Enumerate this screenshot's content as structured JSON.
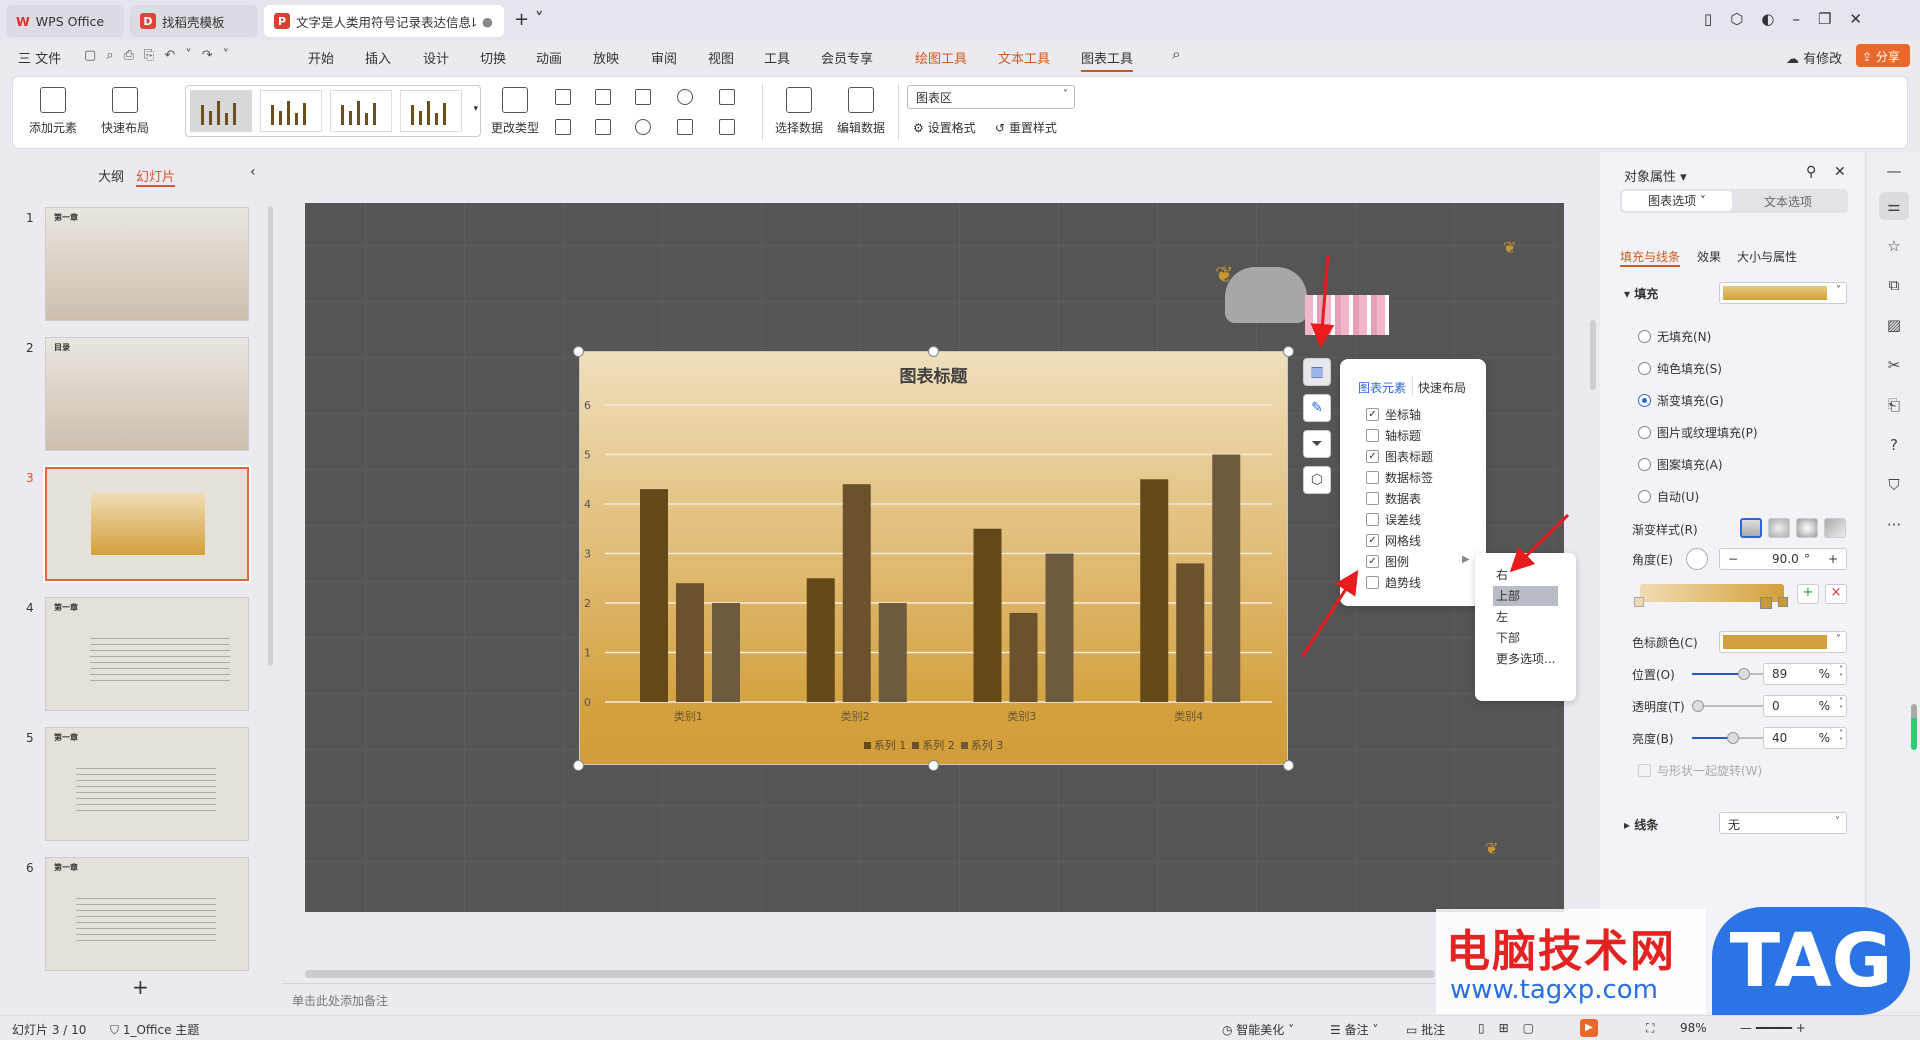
{
  "tabs": [
    {
      "label": "WPS Office",
      "icon": "wps-logo"
    },
    {
      "label": "找稻壳模板",
      "icon": "docer-icon"
    },
    {
      "label": "文字是人类用符号记录表达信息以...",
      "icon": "ppt-icon",
      "active": true
    }
  ],
  "menu": {
    "file": "三 文件",
    "items": [
      "开始",
      "插入",
      "设计",
      "切换",
      "动画",
      "放映",
      "审阅",
      "视图",
      "工具",
      "会员专享"
    ],
    "context": [
      "绘图工具",
      "文本工具",
      "图表工具"
    ],
    "active": "图表工具",
    "modified": "有修改",
    "share": "分享"
  },
  "ribbon": {
    "add_element": "添加元素",
    "quick_layout": "快速布局",
    "change_type": "更改类型",
    "select_data": "选择数据",
    "edit_data": "编辑数据",
    "element_select": "图表区",
    "set_format": "设置格式",
    "reset_style": "重置样式"
  },
  "left_panel": {
    "tabs": [
      "大纲",
      "幻灯片"
    ],
    "active": "幻灯片",
    "slides": [
      {
        "num": "1",
        "title": "第一章"
      },
      {
        "num": "2",
        "title": "目录"
      },
      {
        "num": "3",
        "title": ""
      },
      {
        "num": "4",
        "title": "第一章"
      },
      {
        "num": "5",
        "title": "第一章"
      },
      {
        "num": "6",
        "title": "第一章"
      }
    ],
    "current": "3",
    "add": "+"
  },
  "chart_data": {
    "type": "bar",
    "title": "图表标题",
    "categories": [
      "类别1",
      "类别2",
      "类别3",
      "类别4"
    ],
    "series": [
      {
        "name": "系列 1",
        "values": [
          4.3,
          2.5,
          3.5,
          4.5
        ],
        "color": "#634818"
      },
      {
        "name": "系列 2",
        "values": [
          2.4,
          4.4,
          1.8,
          2.8
        ],
        "color": "#6b522c"
      },
      {
        "name": "系列 3",
        "values": [
          2,
          2,
          3,
          5
        ],
        "color": "#6e5a3e"
      }
    ],
    "yticks": [
      "0",
      "1",
      "2",
      "3",
      "4",
      "5",
      "6"
    ],
    "ylim": [
      0,
      6
    ],
    "grid": true,
    "legend": "bottom"
  },
  "chart_elements": {
    "tabs": [
      "图表元素",
      "快速布局"
    ],
    "items": [
      {
        "label": "坐标轴",
        "checked": true
      },
      {
        "label": "轴标题",
        "checked": false
      },
      {
        "label": "图表标题",
        "checked": true
      },
      {
        "label": "数据标签",
        "checked": false
      },
      {
        "label": "数据表",
        "checked": false
      },
      {
        "label": "误差线",
        "checked": false
      },
      {
        "label": "网格线",
        "checked": true
      },
      {
        "label": "图例",
        "checked": true
      },
      {
        "label": "趋势线",
        "checked": false
      }
    ]
  },
  "legend_submenu": {
    "items": [
      "右",
      "上部",
      "左",
      "下部",
      "更多选项..."
    ],
    "highlighted": "上部"
  },
  "properties": {
    "title": "对象属性",
    "tabs": [
      "图表选项",
      "文本选项"
    ],
    "subtabs": [
      "填充与线条",
      "效果",
      "大小与属性"
    ],
    "fill_label": "填充",
    "fill_options": [
      "无填充(N)",
      "纯色填充(S)",
      "渐变填充(G)",
      "图片或纹理填充(P)",
      "图案填充(A)",
      "自动(U)"
    ],
    "fill_selected": "渐变填充(G)",
    "gradient_style": "渐变样式(R)",
    "angle_label": "角度(E)",
    "angle": "90.0",
    "angle_unit": "°",
    "stop_color": "色标颜色(C)",
    "position_label": "位置(O)",
    "position": "89",
    "transparency_label": "透明度(T)",
    "transparency": "0",
    "brightness_label": "亮度(B)",
    "brightness": "40",
    "pct": "%",
    "rotate_with_shape": "与形状一起旋转(W)",
    "line_label": "线条",
    "line_value": "无",
    "accent": "#d4a03c"
  },
  "notes_placeholder": "单击此处添加备注",
  "status": {
    "slide": "幻灯片 3 / 10",
    "theme": "1_Office 主题",
    "beautify": "智能美化",
    "notes": "备注",
    "comments": "批注",
    "zoom": "98%"
  },
  "watermark": {
    "text": "电脑技术网",
    "url": "www.tagxp.com",
    "tag": "TAG"
  }
}
